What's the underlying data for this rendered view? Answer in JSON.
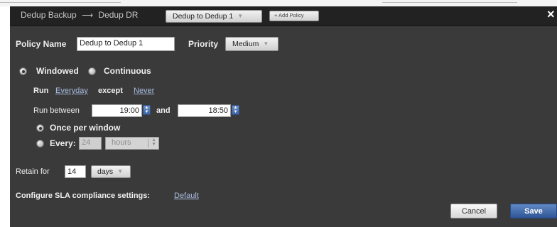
{
  "header": {
    "source": "Dedup Backup",
    "arrow_icon": "long-arrow-right-icon",
    "target": "Dedup DR",
    "policy_select": "Dedup to Dedup 1",
    "add_policy_label": "+ Add Policy",
    "close_icon": "close-icon"
  },
  "policy": {
    "name_label": "Policy Name",
    "name_value": "Dedup to Dedup 1",
    "priority_label": "Priority",
    "priority_value": "Medium"
  },
  "schedule": {
    "mode_windowed": "Windowed",
    "mode_continuous": "Continuous",
    "selected_mode": "Windowed",
    "run_label": "Run",
    "run_days": "Everyday",
    "except_label": "except",
    "except_days": "Never",
    "run_between_label": "Run between",
    "start_time": "19:00",
    "and_label": "and",
    "end_time": "18:50",
    "once_label": "Once per window",
    "every_label": "Every:",
    "every_value": "24",
    "every_unit": "hours",
    "selected_frequency": "Once per window"
  },
  "retention": {
    "label": "Retain for",
    "value": "14",
    "unit": "days"
  },
  "sla": {
    "label": "Configure SLA compliance settings:",
    "link": "Default"
  },
  "buttons": {
    "cancel": "Cancel",
    "save": "Save"
  },
  "colors": {
    "dialog_bg": "#3a3a3a",
    "header_bg": "#222222",
    "link": "#a9bde0",
    "save_button": "#3d66a8"
  }
}
